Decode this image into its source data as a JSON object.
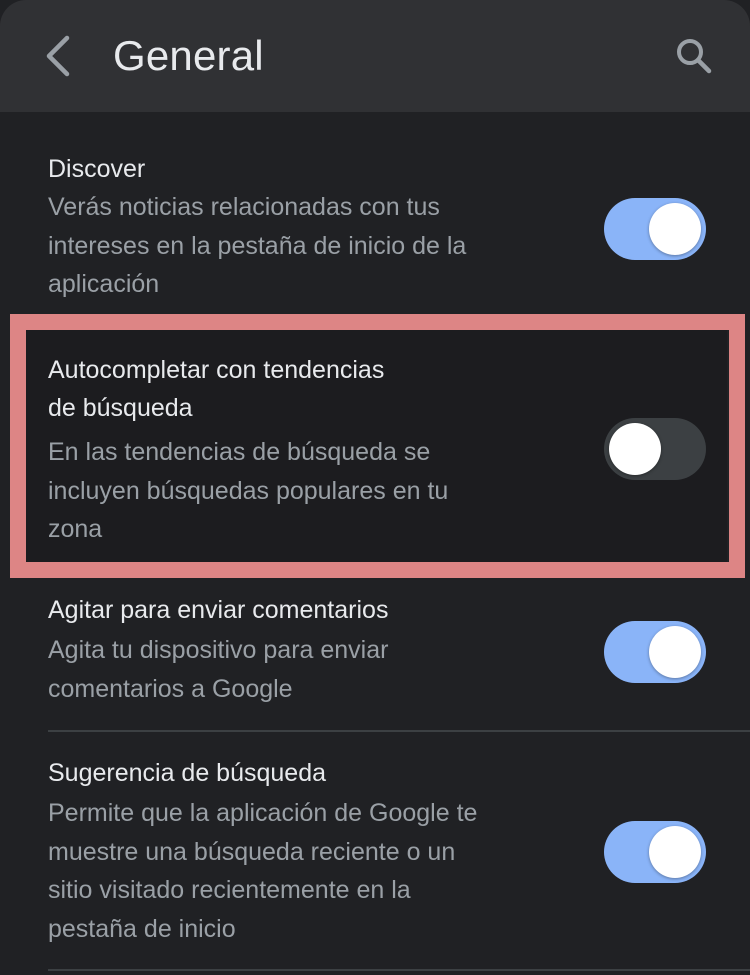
{
  "header": {
    "title": "General",
    "back_icon": "chevron-left-icon",
    "search_icon": "search-icon"
  },
  "colors": {
    "background": "#202124",
    "header": "#303134",
    "toggle_on": "#8ab4f8",
    "toggle_off": "#3c4043",
    "highlight": "#dd8585"
  },
  "settings": [
    {
      "title": "Discover",
      "description_lines": [
        "Verás noticias relacionadas con tus",
        "intereses en la pestaña de inicio de la",
        "aplicación"
      ],
      "enabled": true
    },
    {
      "title_lines": [
        "Autocompletar con tendencias",
        "de búsqueda"
      ],
      "description_lines": [
        "En las tendencias de búsqueda se",
        "incluyen búsquedas populares en tu",
        "zona"
      ],
      "enabled": false,
      "highlighted": true
    },
    {
      "title": "Agitar para enviar comentarios",
      "description_lines": [
        "Agita tu dispositivo para enviar",
        "comentarios a Google"
      ],
      "enabled": true
    },
    {
      "title": "Sugerencia de búsqueda",
      "description_lines": [
        "Permite que la aplicación de Google te",
        "muestre una búsqueda reciente o un",
        "sitio visitado recientemente en la",
        "pestaña de inicio"
      ],
      "enabled": true
    }
  ]
}
